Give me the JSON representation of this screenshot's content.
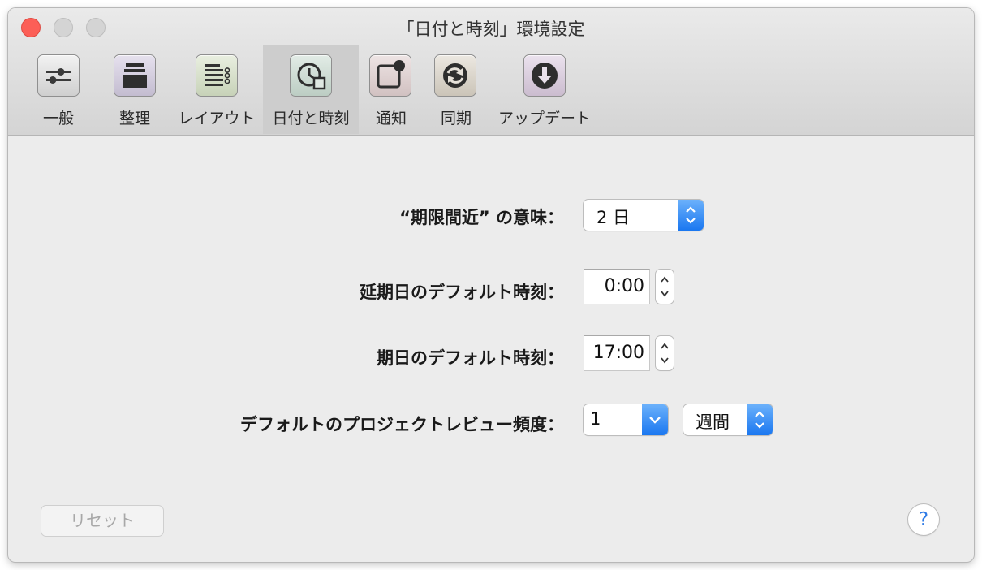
{
  "window": {
    "title": "「日付と時刻」環境設定"
  },
  "toolbar": {
    "selected": "datetime",
    "items": [
      {
        "id": "general",
        "label": "一般",
        "icon": "sliders-icon"
      },
      {
        "id": "organize",
        "label": "整理",
        "icon": "stack-icon"
      },
      {
        "id": "layout",
        "label": "レイアウト",
        "icon": "list-layout-icon"
      },
      {
        "id": "datetime",
        "label": "日付と時刻",
        "icon": "clock-calendar-icon"
      },
      {
        "id": "notifications",
        "label": "通知",
        "icon": "notification-badge-icon"
      },
      {
        "id": "sync",
        "label": "同期",
        "icon": "sync-icon"
      },
      {
        "id": "update",
        "label": "アップデート",
        "icon": "download-arrow-icon"
      }
    ]
  },
  "form": {
    "due_soon_label": "“期限間近” の意味：",
    "due_soon_value": "2 日",
    "defer_time_label": "延期日のデフォルト時刻：",
    "defer_time_value": "0:00",
    "due_time_label": "期日のデフォルト時刻：",
    "due_time_value": "17:00",
    "review_label": "デフォルトのプロジェクトレビュー頻度：",
    "review_count_value": "1",
    "review_unit_value": "週間"
  },
  "footer": {
    "reset_label": "リセット",
    "help_label": "?"
  },
  "colors": {
    "accent": "#1a77f0",
    "close_button": "#fc5f57",
    "help_text": "#2f7be6"
  }
}
